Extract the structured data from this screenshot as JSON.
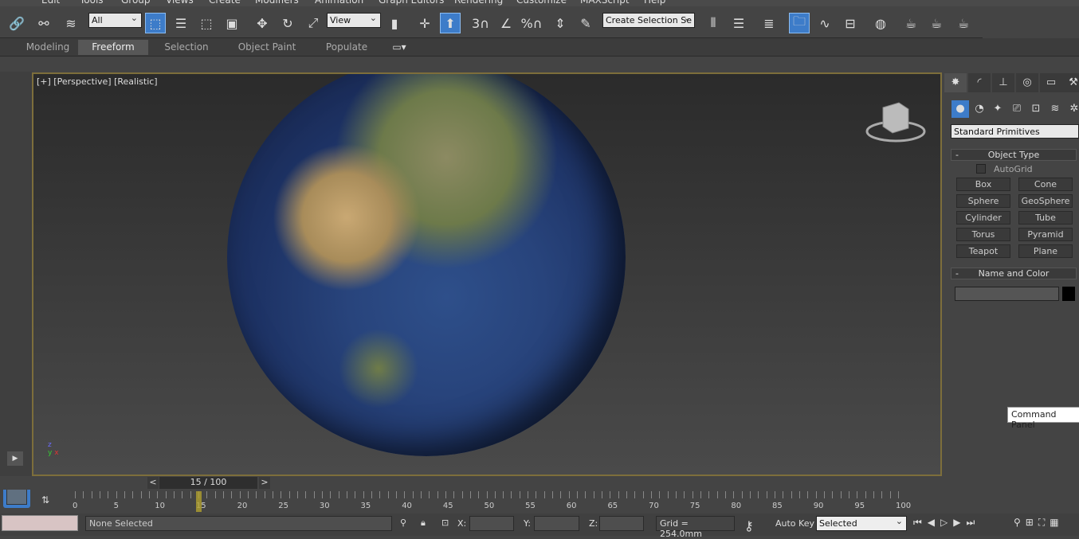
{
  "menu": [
    "Edit",
    "Tools",
    "Group",
    "Views",
    "Create",
    "Modifiers",
    "Animation",
    "Graph Editors",
    "Rendering",
    "Customize",
    "MAXScript",
    "Help"
  ],
  "toolbar": {
    "selection_filter": "All",
    "ref_coord": "View",
    "selection_set": "Create Selection Se",
    "snap_label": "3",
    "percent_snap": "%"
  },
  "ribbon": {
    "tabs": [
      "Modeling",
      "Freeform",
      "Selection",
      "Object Paint",
      "Populate"
    ],
    "active": "Freeform"
  },
  "viewport": {
    "label": "[+] [Perspective] [Realistic]",
    "axis": {
      "x": "x",
      "y": "y",
      "z": "z"
    }
  },
  "command_panel": {
    "tabs": [
      "create",
      "modify",
      "hierarchy",
      "motion",
      "display",
      "utilities"
    ],
    "category": "Standard Primitives",
    "object_type": {
      "title": "Object Type",
      "collapse": "-",
      "autogrid": "AutoGrid",
      "autogrid_checked": false,
      "buttons": [
        "Box",
        "Cone",
        "Sphere",
        "GeoSphere",
        "Cylinder",
        "Tube",
        "Torus",
        "Pyramid",
        "Teapot",
        "Plane"
      ]
    },
    "name_color": {
      "title": "Name and Color",
      "collapse": "-",
      "name": "",
      "color": "#000000"
    },
    "tooltip": "Command Panel"
  },
  "timeline": {
    "frame": "15 / 100",
    "prev": "<",
    "next": ">",
    "current": 15,
    "max": 100,
    "labels": [
      "0",
      "5",
      "10",
      "15",
      "20",
      "25",
      "30",
      "35",
      "40",
      "45",
      "50",
      "55",
      "60",
      "65",
      "70",
      "75",
      "80",
      "85",
      "90",
      "95",
      "100"
    ]
  },
  "status": {
    "selection": "None Selected",
    "x_label": "X:",
    "y_label": "Y:",
    "z_label": "Z:",
    "x": "",
    "y": "",
    "z": "",
    "grid": "Grid = 254.0mm",
    "auto_key": "Auto Key",
    "key_filter": "Selected"
  },
  "colors": {
    "accent": "#3d7cc9",
    "viewport_border": "#7d6e3b",
    "time_marker": "#b0a030"
  }
}
